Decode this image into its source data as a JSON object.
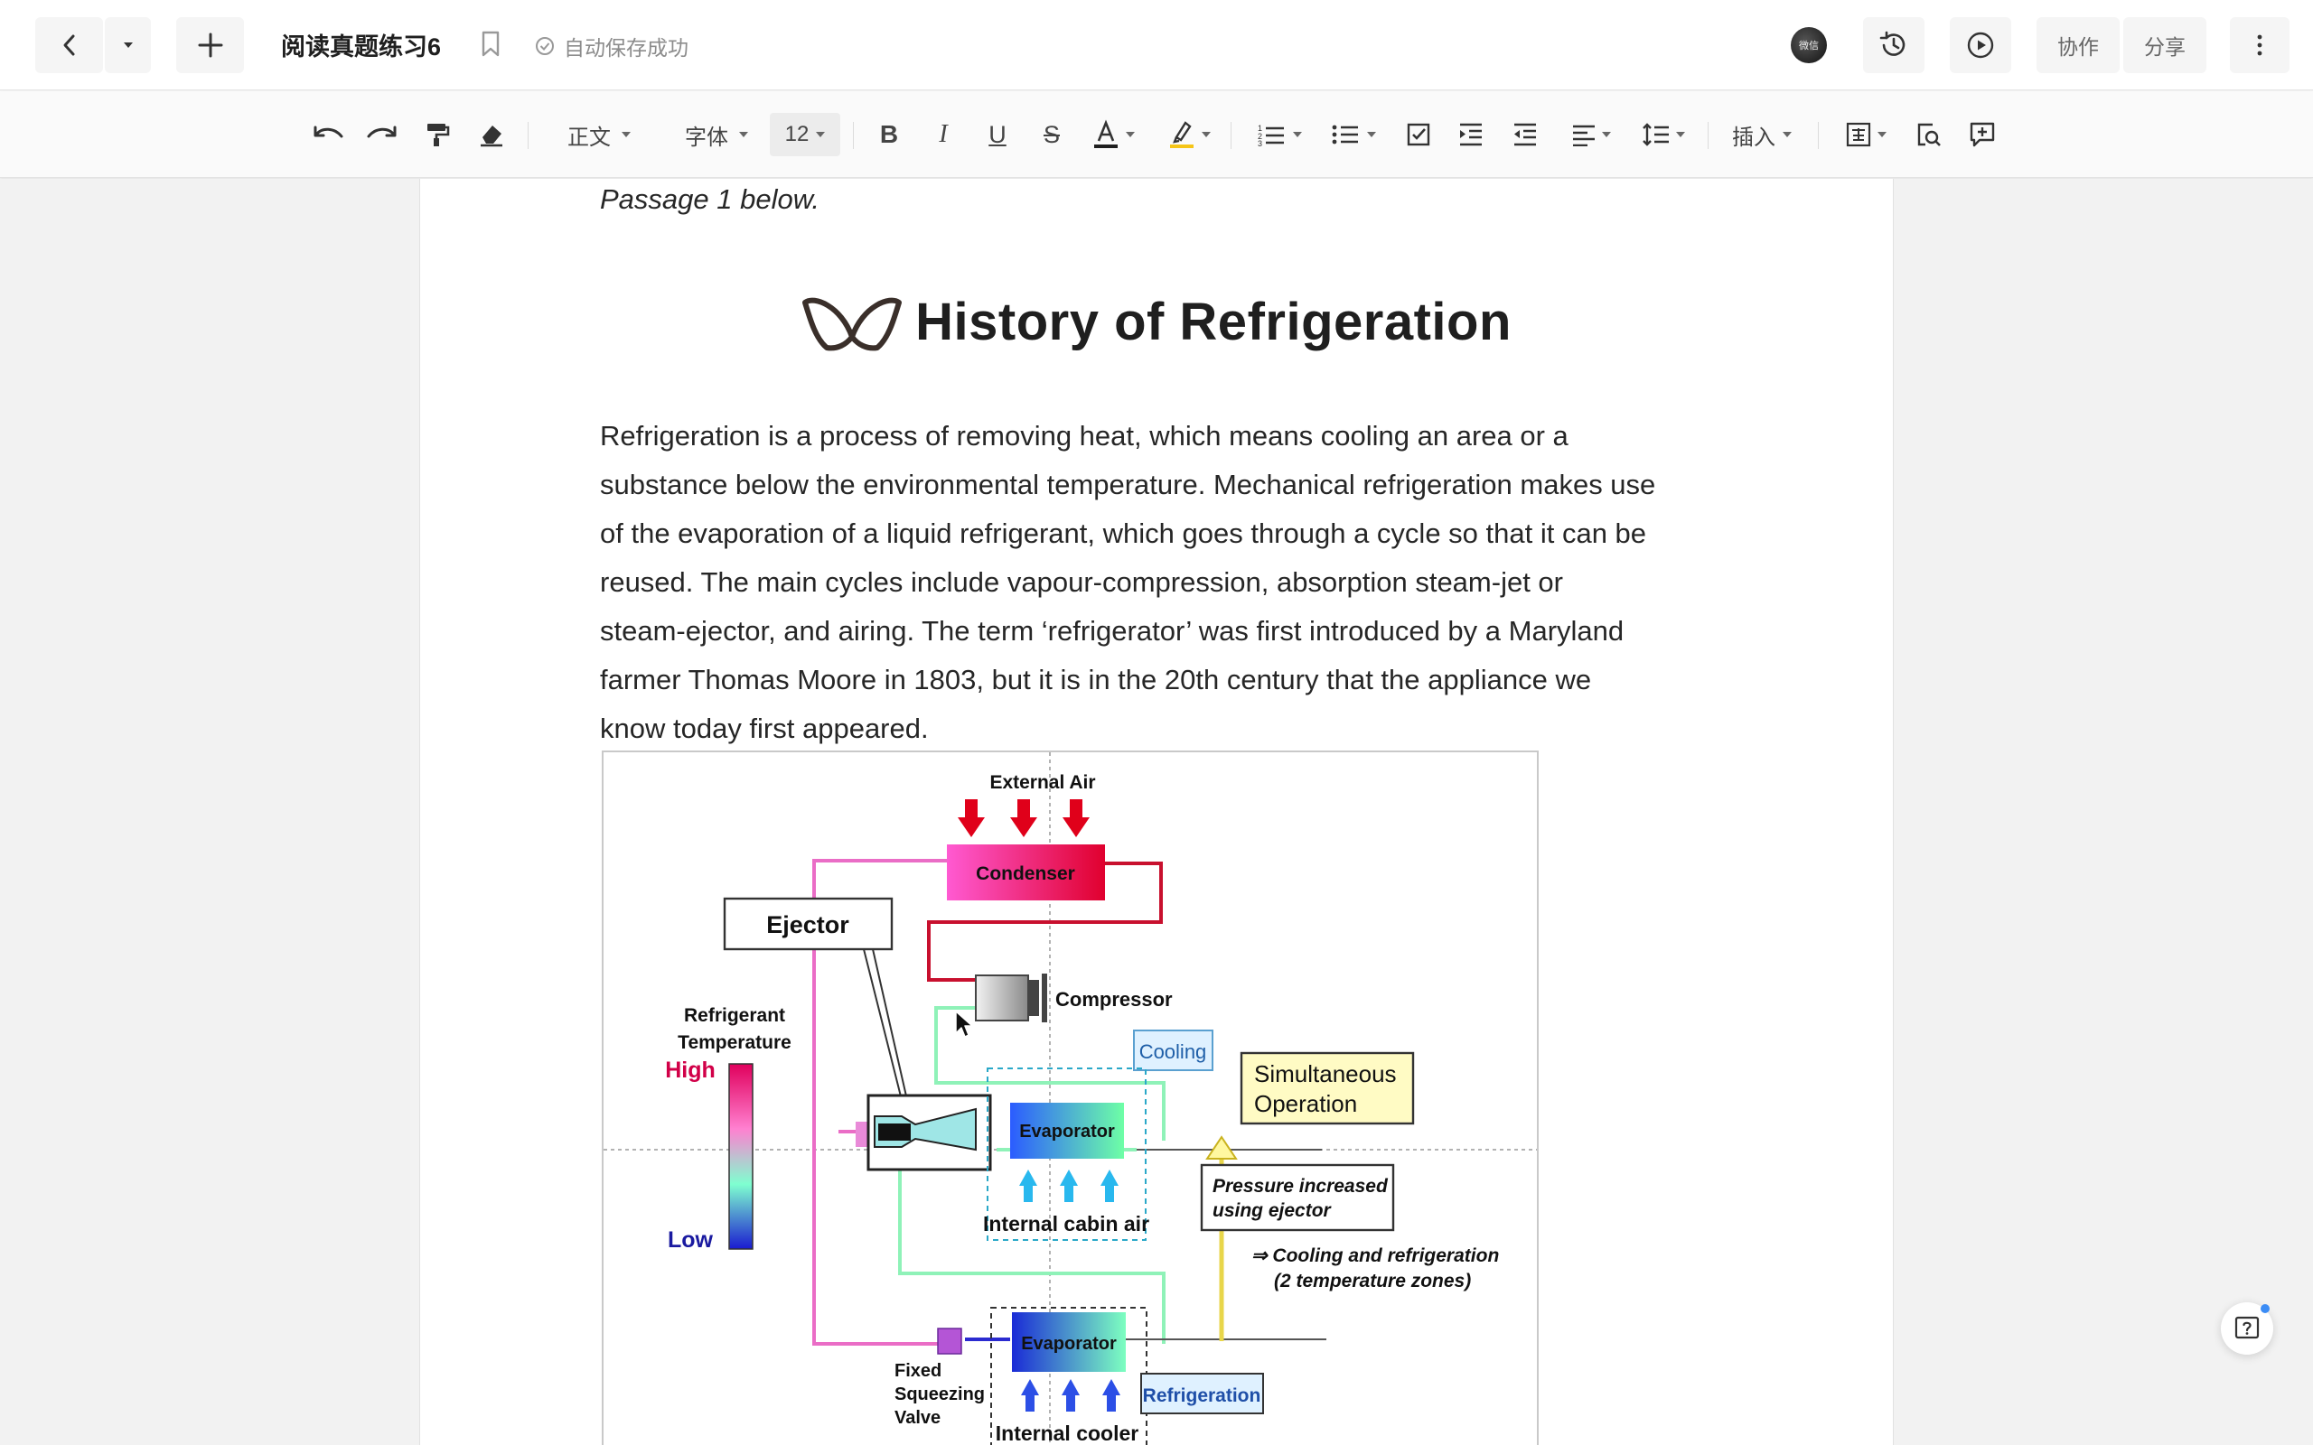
{
  "header": {
    "doc_title": "阅读真题练习6",
    "save_status": "自动保存成功",
    "collab_label": "协作",
    "share_label": "分享",
    "avatar_text": "微信"
  },
  "toolbar": {
    "paragraph_style": "正文",
    "font_family": "字体",
    "font_size": "12",
    "insert_label": "插入",
    "text_color": "#1f1f1f",
    "highlight_color": "#f5c518"
  },
  "document": {
    "intro_line": "Passage 1 below.",
    "heading": "History of Refrigeration",
    "paragraph_lines": [
      "Refrigeration is a process of removing heat, which means cooling an area or a",
      "substance below the environmental temperature. Mechanical refrigeration makes use",
      "of the evaporation of a liquid refrigerant, which goes through a cycle so that it can be",
      "reused. The main cycles include vapour-compression, absorption steam-jet or",
      "steam-ejector, and airing. The term ‘refrigerator’ was first introduced by a Maryland",
      "farmer Thomas Moore in 1803, but it is in the 20th century that the appliance we",
      "know today first appeared."
    ]
  },
  "figure": {
    "external_air": "External Air",
    "condenser": "Condenser",
    "ejector": "Ejector",
    "compressor": "Compressor",
    "refrigerant_temp_line1": "Refrigerant",
    "refrigerant_temp_line2": "Temperature",
    "high": "High",
    "low": "Low",
    "cooling": "Cooling",
    "simultaneous_line1": "Simultaneous",
    "simultaneous_line2": "Operation",
    "evaporator_top": "Evaporator",
    "internal_cabin_air": "Internal cabin air",
    "pressure_line1": "Pressure increased",
    "pressure_line2": "using ejector",
    "cooling_refrig_line1": "⇒ Cooling and refrigeration",
    "cooling_refrig_line2": "(2 temperature zones)",
    "evaporator_bottom": "Evaporator",
    "refrigeration": "Refrigeration",
    "fixed_line1": "Fixed",
    "fixed_line2": "Squeezing",
    "fixed_line3": "Valve",
    "internal_cooler": "Internal cooler"
  }
}
